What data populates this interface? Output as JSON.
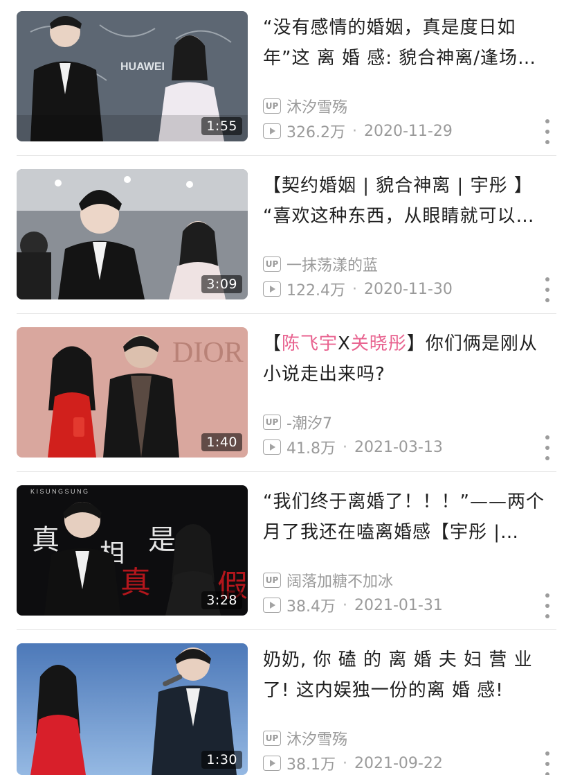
{
  "videos": [
    {
      "title_line1": "“没有感情的婚姻，真是度日如",
      "title_line2": "年”这 离 婚 感: 貌合神离/逢场…",
      "uploader": "沐汐雪殇",
      "views": "326.2万",
      "date": "2020-11-29",
      "duration": "1:55"
    },
    {
      "title_line1": "【契约婚姻 | 貌合神离 | 宇彤 】",
      "title_line2": "“喜欢这种东西，从眼睛就可以…",
      "uploader": "一抹荡漾的蓝",
      "views": "122.4万",
      "date": "2020-11-30",
      "duration": "3:09"
    },
    {
      "title_open": "【",
      "title_name1": "陈飞宇",
      "title_x": "X",
      "title_name2": "关晓彤",
      "title_rest": "】你们俩是刚从",
      "title_line2": "小说走出来吗?",
      "uploader": "-潮汐7",
      "views": "41.8万",
      "date": "2021-03-13",
      "duration": "1:40"
    },
    {
      "title_line1": "“我们终于离婚了！！！”——两个",
      "title_line2": "月了我还在嗑离婚感【宇彤 |…",
      "uploader": "阔落加糖不加冰",
      "views": "38.4万",
      "date": "2021-01-31",
      "duration": "3:28"
    },
    {
      "title_line1": "奶奶, 你 磕 的 离 婚 夫 妇 营 业",
      "title_line2": "了! 这内娱独一份的离 婚 感!",
      "uploader": "沐汐雪殇",
      "views": "38.1万",
      "date": "2021-09-22",
      "duration": "1:30"
    }
  ],
  "thumb_text": {
    "v0": "HUAWEI",
    "v2": "DIOR",
    "v3_top": "K I S U N G S U N G",
    "v3_char1": "真",
    "v3_char2": "相",
    "v3_char3": "是",
    "v3_char4": "真",
    "v3_char5": "假"
  },
  "badges": {
    "up_label": "UP",
    "separator": "·"
  },
  "icons": {
    "up": "up-badge-icon",
    "views": "play-count-icon",
    "more": "more-vertical-icon"
  },
  "colors": {
    "accent_pink": "#e8628f",
    "meta_gray": "#9a9a9a"
  }
}
